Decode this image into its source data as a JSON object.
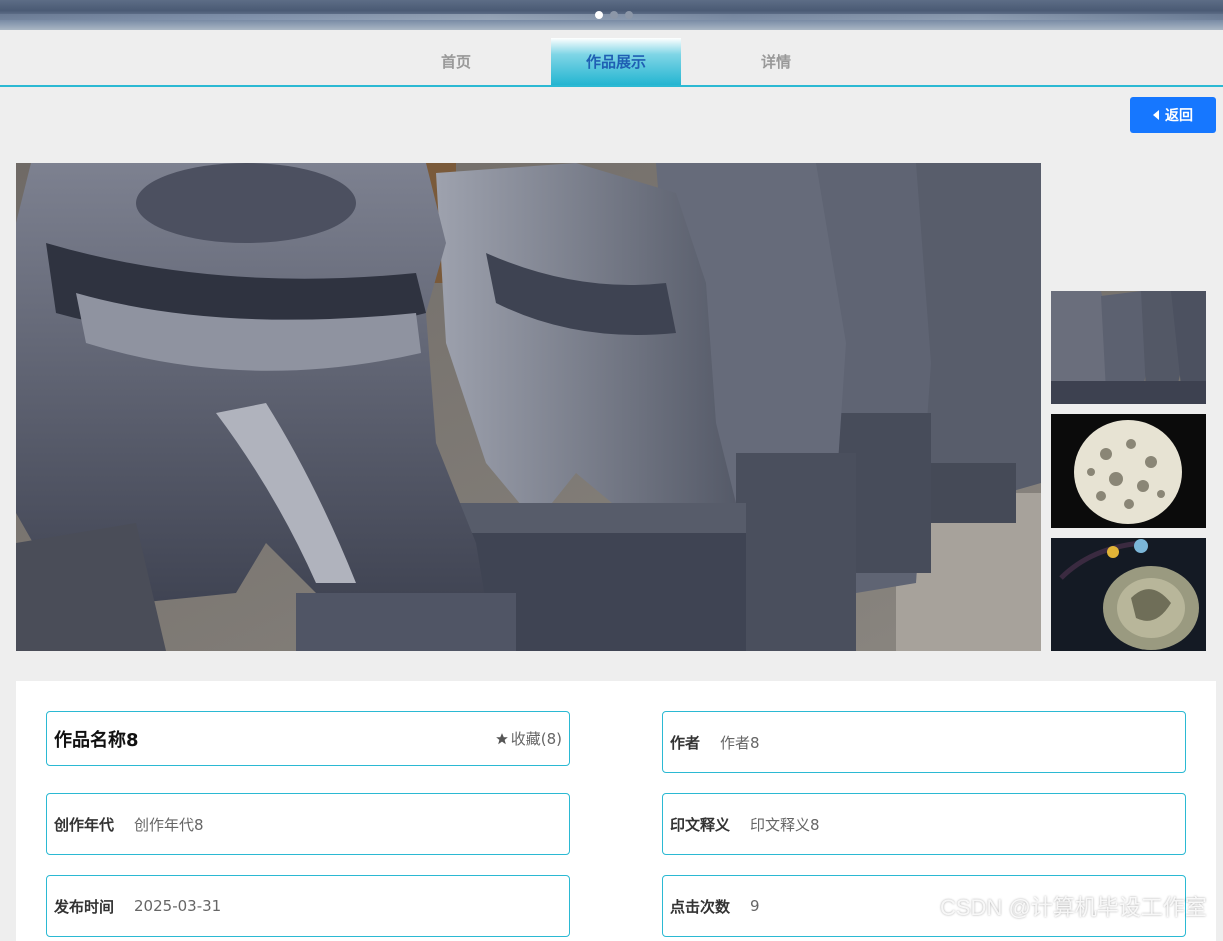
{
  "carousel": {
    "slide_count": 3,
    "active_index": 0
  },
  "tabs": [
    {
      "label": "首页",
      "active": false
    },
    {
      "label": "作品展示",
      "active": true
    },
    {
      "label": "详情",
      "active": false
    }
  ],
  "back_button": {
    "label": "返回"
  },
  "gallery": {
    "main_image": "stone-lion-statues",
    "thumbnails": [
      "stone-lion-statues",
      "carved-white-egg",
      "jade-pendant"
    ]
  },
  "details": {
    "title": "作品名称8",
    "favorite_label": "收藏(8)",
    "fields": [
      {
        "label": "作者",
        "value": "作者8"
      },
      {
        "label": "创作年代",
        "value": "创作年代8"
      },
      {
        "label": "印文释义",
        "value": "印文释义8"
      },
      {
        "label": "发布时间",
        "value": "2025-03-31"
      },
      {
        "label": "点击次数",
        "value": "9"
      }
    ]
  },
  "watermark": "CSDN @计算机毕设工作室",
  "colors": {
    "accent": "#2bb9d3",
    "primary_button": "#1677ff",
    "tab_active_text": "#1f5fb3"
  }
}
